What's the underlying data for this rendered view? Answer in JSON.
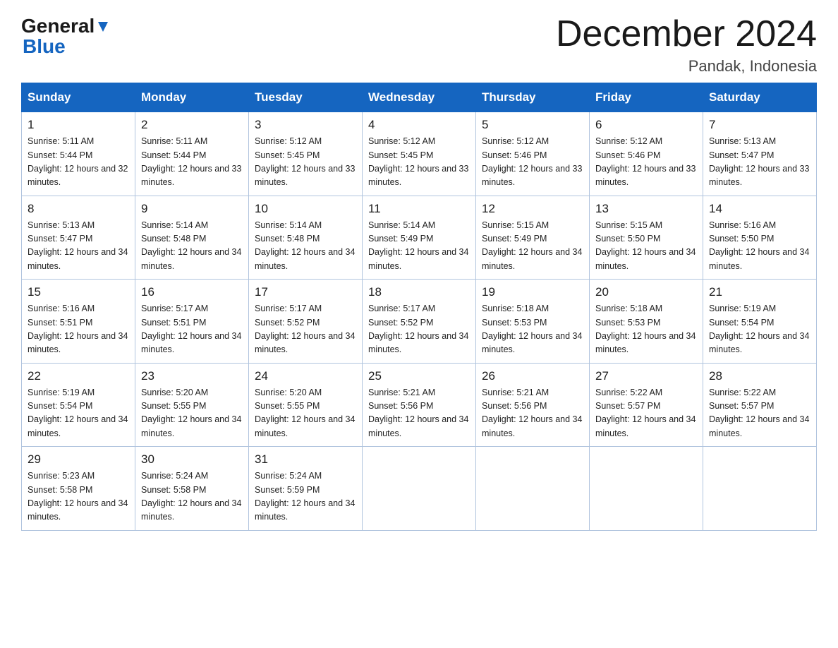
{
  "header": {
    "logo_line1": "General",
    "logo_line2": "Blue",
    "main_title": "December 2024",
    "subtitle": "Pandak, Indonesia"
  },
  "days_of_week": [
    "Sunday",
    "Monday",
    "Tuesday",
    "Wednesday",
    "Thursday",
    "Friday",
    "Saturday"
  ],
  "weeks": [
    [
      {
        "day": "1",
        "sunrise": "5:11 AM",
        "sunset": "5:44 PM",
        "daylight": "12 hours and 32 minutes."
      },
      {
        "day": "2",
        "sunrise": "5:11 AM",
        "sunset": "5:44 PM",
        "daylight": "12 hours and 33 minutes."
      },
      {
        "day": "3",
        "sunrise": "5:12 AM",
        "sunset": "5:45 PM",
        "daylight": "12 hours and 33 minutes."
      },
      {
        "day": "4",
        "sunrise": "5:12 AM",
        "sunset": "5:45 PM",
        "daylight": "12 hours and 33 minutes."
      },
      {
        "day": "5",
        "sunrise": "5:12 AM",
        "sunset": "5:46 PM",
        "daylight": "12 hours and 33 minutes."
      },
      {
        "day": "6",
        "sunrise": "5:12 AM",
        "sunset": "5:46 PM",
        "daylight": "12 hours and 33 minutes."
      },
      {
        "day": "7",
        "sunrise": "5:13 AM",
        "sunset": "5:47 PM",
        "daylight": "12 hours and 33 minutes."
      }
    ],
    [
      {
        "day": "8",
        "sunrise": "5:13 AM",
        "sunset": "5:47 PM",
        "daylight": "12 hours and 34 minutes."
      },
      {
        "day": "9",
        "sunrise": "5:14 AM",
        "sunset": "5:48 PM",
        "daylight": "12 hours and 34 minutes."
      },
      {
        "day": "10",
        "sunrise": "5:14 AM",
        "sunset": "5:48 PM",
        "daylight": "12 hours and 34 minutes."
      },
      {
        "day": "11",
        "sunrise": "5:14 AM",
        "sunset": "5:49 PM",
        "daylight": "12 hours and 34 minutes."
      },
      {
        "day": "12",
        "sunrise": "5:15 AM",
        "sunset": "5:49 PM",
        "daylight": "12 hours and 34 minutes."
      },
      {
        "day": "13",
        "sunrise": "5:15 AM",
        "sunset": "5:50 PM",
        "daylight": "12 hours and 34 minutes."
      },
      {
        "day": "14",
        "sunrise": "5:16 AM",
        "sunset": "5:50 PM",
        "daylight": "12 hours and 34 minutes."
      }
    ],
    [
      {
        "day": "15",
        "sunrise": "5:16 AM",
        "sunset": "5:51 PM",
        "daylight": "12 hours and 34 minutes."
      },
      {
        "day": "16",
        "sunrise": "5:17 AM",
        "sunset": "5:51 PM",
        "daylight": "12 hours and 34 minutes."
      },
      {
        "day": "17",
        "sunrise": "5:17 AM",
        "sunset": "5:52 PM",
        "daylight": "12 hours and 34 minutes."
      },
      {
        "day": "18",
        "sunrise": "5:17 AM",
        "sunset": "5:52 PM",
        "daylight": "12 hours and 34 minutes."
      },
      {
        "day": "19",
        "sunrise": "5:18 AM",
        "sunset": "5:53 PM",
        "daylight": "12 hours and 34 minutes."
      },
      {
        "day": "20",
        "sunrise": "5:18 AM",
        "sunset": "5:53 PM",
        "daylight": "12 hours and 34 minutes."
      },
      {
        "day": "21",
        "sunrise": "5:19 AM",
        "sunset": "5:54 PM",
        "daylight": "12 hours and 34 minutes."
      }
    ],
    [
      {
        "day": "22",
        "sunrise": "5:19 AM",
        "sunset": "5:54 PM",
        "daylight": "12 hours and 34 minutes."
      },
      {
        "day": "23",
        "sunrise": "5:20 AM",
        "sunset": "5:55 PM",
        "daylight": "12 hours and 34 minutes."
      },
      {
        "day": "24",
        "sunrise": "5:20 AM",
        "sunset": "5:55 PM",
        "daylight": "12 hours and 34 minutes."
      },
      {
        "day": "25",
        "sunrise": "5:21 AM",
        "sunset": "5:56 PM",
        "daylight": "12 hours and 34 minutes."
      },
      {
        "day": "26",
        "sunrise": "5:21 AM",
        "sunset": "5:56 PM",
        "daylight": "12 hours and 34 minutes."
      },
      {
        "day": "27",
        "sunrise": "5:22 AM",
        "sunset": "5:57 PM",
        "daylight": "12 hours and 34 minutes."
      },
      {
        "day": "28",
        "sunrise": "5:22 AM",
        "sunset": "5:57 PM",
        "daylight": "12 hours and 34 minutes."
      }
    ],
    [
      {
        "day": "29",
        "sunrise": "5:23 AM",
        "sunset": "5:58 PM",
        "daylight": "12 hours and 34 minutes."
      },
      {
        "day": "30",
        "sunrise": "5:24 AM",
        "sunset": "5:58 PM",
        "daylight": "12 hours and 34 minutes."
      },
      {
        "day": "31",
        "sunrise": "5:24 AM",
        "sunset": "5:59 PM",
        "daylight": "12 hours and 34 minutes."
      },
      null,
      null,
      null,
      null
    ]
  ]
}
